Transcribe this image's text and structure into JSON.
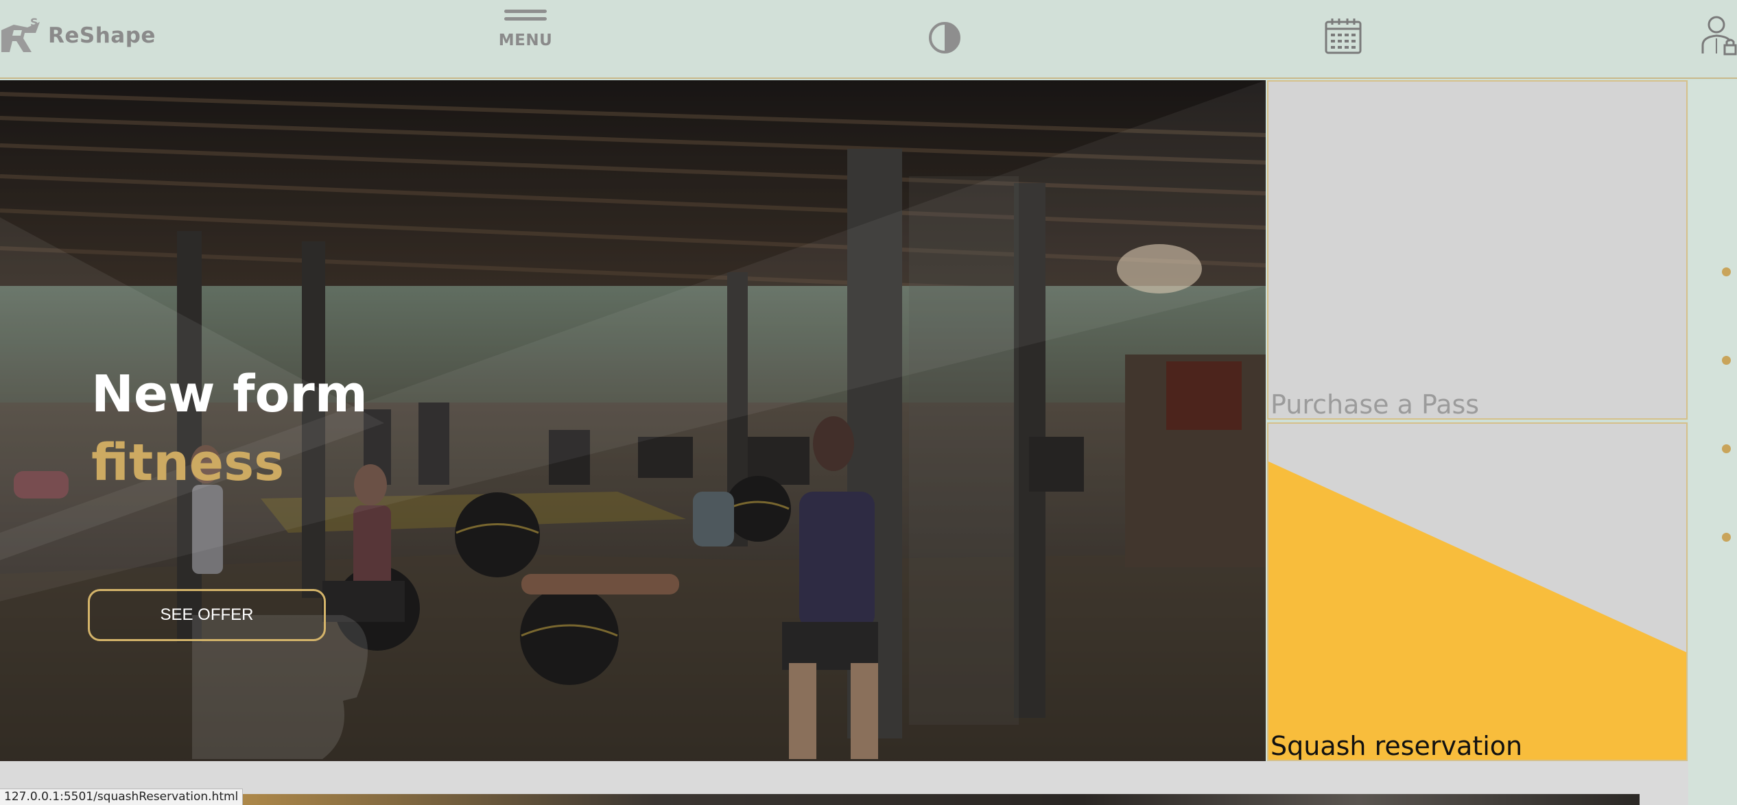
{
  "header": {
    "logo_text": "ReShape",
    "menu_label": "MENU",
    "icons": [
      "logo-mark-icon",
      "hamburger-icon",
      "contrast-icon",
      "calendar-icon",
      "user-lock-icon"
    ]
  },
  "hero": {
    "title_line1": "New form",
    "title_line2": "fitness",
    "cta_label": "SEE OFFER"
  },
  "cards": [
    {
      "title": "Purchase a Pass"
    },
    {
      "title": "Squash reservation"
    }
  ],
  "carousel": {
    "dot_count": 4
  },
  "status_bar": {
    "url": "127.0.0.1:5501/squashReservation.html"
  },
  "colors": {
    "header_bg": "#d2e0d8",
    "accent_gold": "#cdaa62",
    "squash_yellow": "#f8bd3c",
    "card_bg": "#d4d4d4"
  }
}
